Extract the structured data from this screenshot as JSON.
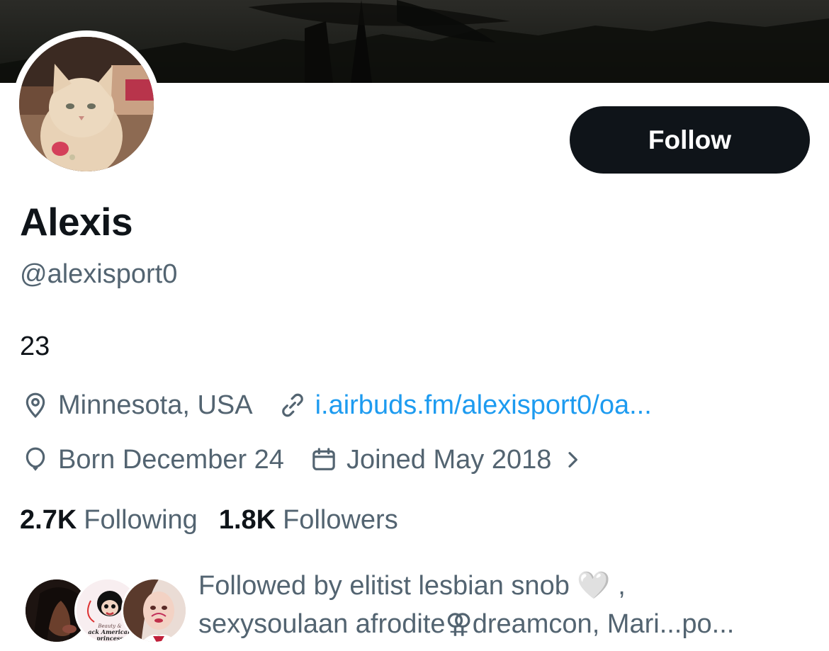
{
  "profile": {
    "name": "Alexis",
    "handle": "@alexisport0",
    "bio": "23",
    "follow_label": "Follow"
  },
  "meta": {
    "location": "Minnesota, USA",
    "link": "i.airbuds.fm/alexisport0/oa...",
    "birthday": "Born December 24",
    "joined": "Joined May 2018"
  },
  "stats": {
    "following_count": "2.7K",
    "following_label": "Following",
    "followers_count": "1.8K",
    "followers_label": "Followers"
  },
  "followed_by": {
    "line1": "Followed by elitist lesbian snob 🤍 ,",
    "line2": "sexysoulaan afrodite⚢dreamcon, Mari...po...",
    "badge_text_1": "Beauty &",
    "badge_text_2": "ack American",
    "badge_text_3": "princess"
  },
  "icons": {
    "location": "location-pin-icon",
    "link": "link-icon",
    "birthday": "balloon-icon",
    "joined": "calendar-icon",
    "chevron": "chevron-right-icon"
  },
  "colors": {
    "accent": "#1d9bf0",
    "primary_text": "#0f1419",
    "secondary_text": "#536471",
    "button_bg": "#0f1419"
  }
}
